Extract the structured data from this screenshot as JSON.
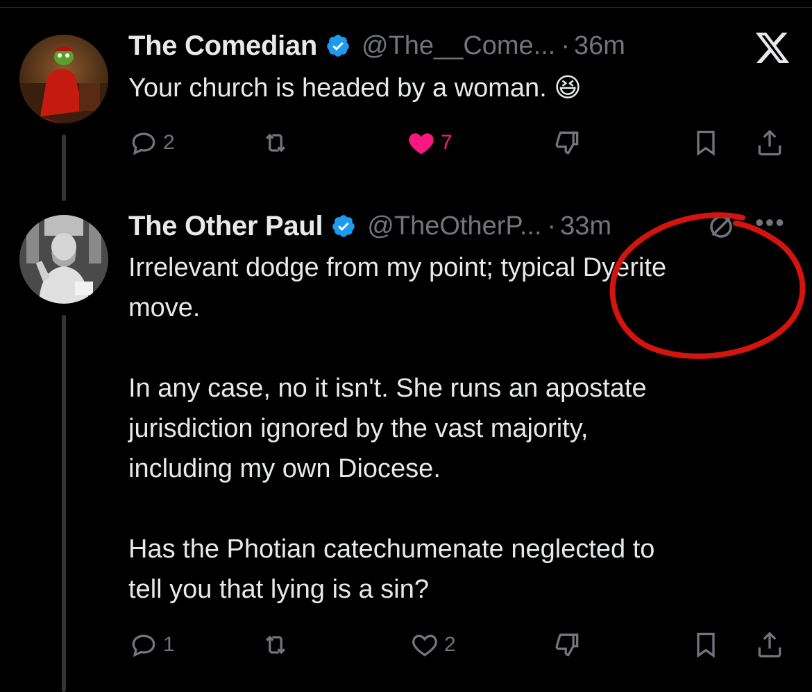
{
  "tweets": [
    {
      "name": "The Comedian",
      "handle": "@The__Come...",
      "time": "36m",
      "text": "Your church is headed by a woman. 😆",
      "replies": "2",
      "likes": "7",
      "liked": true
    },
    {
      "name": "The Other Paul",
      "handle": "@TheOtherP...",
      "time": "33m",
      "text": "Irrelevant dodge from my point; typical Dyerite\nmove.\n\nIn any case, no it isn't. She runs an apostate\njurisdiction ignored by the vast majority,\nincluding my own Diocese.\n\nHas the Photian catechumenate neglected to\ntell you that lying is a sin?",
      "replies": "1",
      "likes": "2",
      "liked": false
    }
  ],
  "separator": "·",
  "more_label": "•••",
  "colors": {
    "verified": "#1d9bf0",
    "like_active": "#f91880",
    "muted": "#71767b",
    "annotation": "#d4140e"
  }
}
